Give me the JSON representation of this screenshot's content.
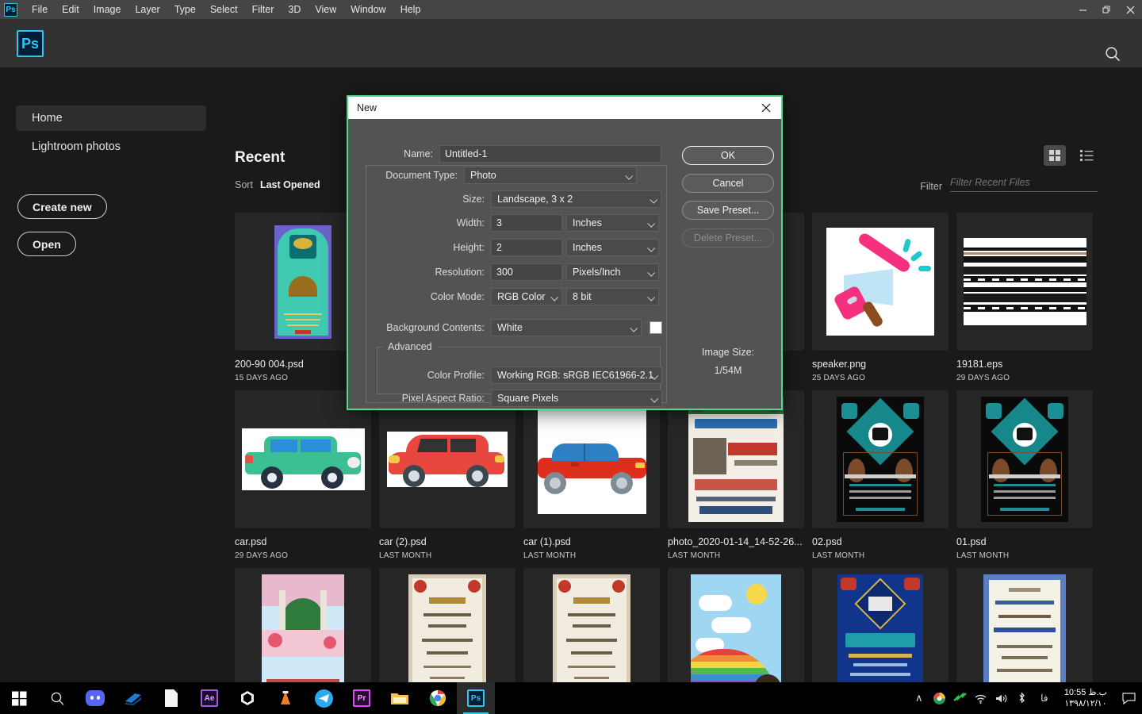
{
  "window": {
    "menu_items": [
      "File",
      "Edit",
      "Image",
      "Layer",
      "Type",
      "Select",
      "Filter",
      "3D",
      "View",
      "Window",
      "Help"
    ],
    "logo_text": "Ps",
    "controls": {
      "minimize": "—",
      "restore": "❐",
      "close": "✕"
    }
  },
  "header": {
    "search_icon": "search-icon"
  },
  "sidebar": {
    "items": [
      {
        "label": "Home",
        "active": true
      },
      {
        "label": "Lightroom photos",
        "active": false
      }
    ],
    "buttons": [
      {
        "label": "Create new"
      },
      {
        "label": "Open"
      }
    ]
  },
  "recent": {
    "title": "Recent",
    "sort_label": "Sort",
    "sort_value": "Last Opened",
    "filter_label": "Filter",
    "filter_placeholder": "Filter Recent Files",
    "filter_value": "",
    "view_grid": "grid-view-icon",
    "view_list": "list-view-icon",
    "files": [
      {
        "name": "200-90 004.psd",
        "date": "15 DAYS AGO",
        "art": "poster-teal"
      },
      {
        "name": "",
        "date": "",
        "art": "hidden"
      },
      {
        "name": "",
        "date": "",
        "art": "hidden"
      },
      {
        "name": "",
        "date": "",
        "art": "hidden"
      },
      {
        "name": "speaker.png",
        "date": "25 DAYS AGO",
        "art": "megaphone"
      },
      {
        "name": "19181.eps",
        "date": "29 DAYS AGO",
        "art": "stripes"
      },
      {
        "name": "car.psd",
        "date": "29 DAYS AGO",
        "art": "car-green"
      },
      {
        "name": "car (2).psd",
        "date": "LAST MONTH",
        "art": "car-red"
      },
      {
        "name": "car (1).psd",
        "date": "LAST MONTH",
        "art": "car-sedan"
      },
      {
        "name": "photo_2020-01-14_14-52-26...",
        "date": "LAST MONTH",
        "art": "poster-politic"
      },
      {
        "name": "02.psd",
        "date": "LAST MONTH",
        "art": "poster-black"
      },
      {
        "name": "01.psd",
        "date": "LAST MONTH",
        "art": "poster-black"
      },
      {
        "name": "",
        "date": "",
        "art": "poster-mosque"
      },
      {
        "name": "",
        "date": "",
        "art": "poster-cream"
      },
      {
        "name": "",
        "date": "",
        "art": "poster-cream"
      },
      {
        "name": "",
        "date": "",
        "art": "poster-rainbow"
      },
      {
        "name": "",
        "date": "",
        "art": "poster-blue"
      },
      {
        "name": "",
        "date": "",
        "art": "poster-blue-cert"
      }
    ]
  },
  "dialog": {
    "title": "New",
    "close_icon": "close-icon",
    "fields": {
      "name_label": "Name:",
      "name_value": "Untitled-1",
      "doctype_label": "Document Type:",
      "doctype_value": "Photo",
      "size_label": "Size:",
      "size_value": "Landscape, 3 x 2",
      "width_label": "Width:",
      "width_value": "3",
      "width_unit": "Inches",
      "height_label": "Height:",
      "height_value": "2",
      "height_unit": "Inches",
      "resolution_label": "Resolution:",
      "resolution_value": "300",
      "resolution_unit": "Pixels/Inch",
      "colormode_label": "Color Mode:",
      "colormode_value": "RGB Color",
      "colordepth_value": "8 bit",
      "background_label": "Background Contents:",
      "background_value": "White",
      "background_swatch": "#ffffff",
      "advanced_label": "Advanced",
      "colorprofile_label": "Color Profile:",
      "colorprofile_value": "Working RGB:  sRGB IEC61966-2.1",
      "pixelaspect_label": "Pixel Aspect Ratio:",
      "pixelaspect_value": "Square Pixels"
    },
    "buttons": {
      "ok": "OK",
      "cancel": "Cancel",
      "save_preset": "Save Preset...",
      "delete_preset": "Delete Preset..."
    },
    "image_size_label": "Image Size:",
    "image_size_value": "1/54M",
    "accent_border": "#4fdc8a"
  },
  "taskbar": {
    "items": [
      {
        "name": "start",
        "glyph": "⊞"
      },
      {
        "name": "search",
        "glyph": "⌕"
      },
      {
        "name": "discord",
        "glyph": ""
      },
      {
        "name": "vegas",
        "glyph": ""
      },
      {
        "name": "notepad",
        "glyph": ""
      },
      {
        "name": "after-effects",
        "glyph": "Ae"
      },
      {
        "name": "unity",
        "glyph": ""
      },
      {
        "name": "vlc",
        "glyph": ""
      },
      {
        "name": "telegram",
        "glyph": ""
      },
      {
        "name": "premiere-pro",
        "glyph": "Pr"
      },
      {
        "name": "file-explorer",
        "glyph": ""
      },
      {
        "name": "chrome",
        "glyph": ""
      },
      {
        "name": "photoshop",
        "glyph": "Ps"
      }
    ],
    "tray": {
      "chevron": "∧",
      "language": "فا",
      "time": "10:55 ب.ظ",
      "date": "۱۳۹۸/۱۲/۱۰"
    }
  }
}
